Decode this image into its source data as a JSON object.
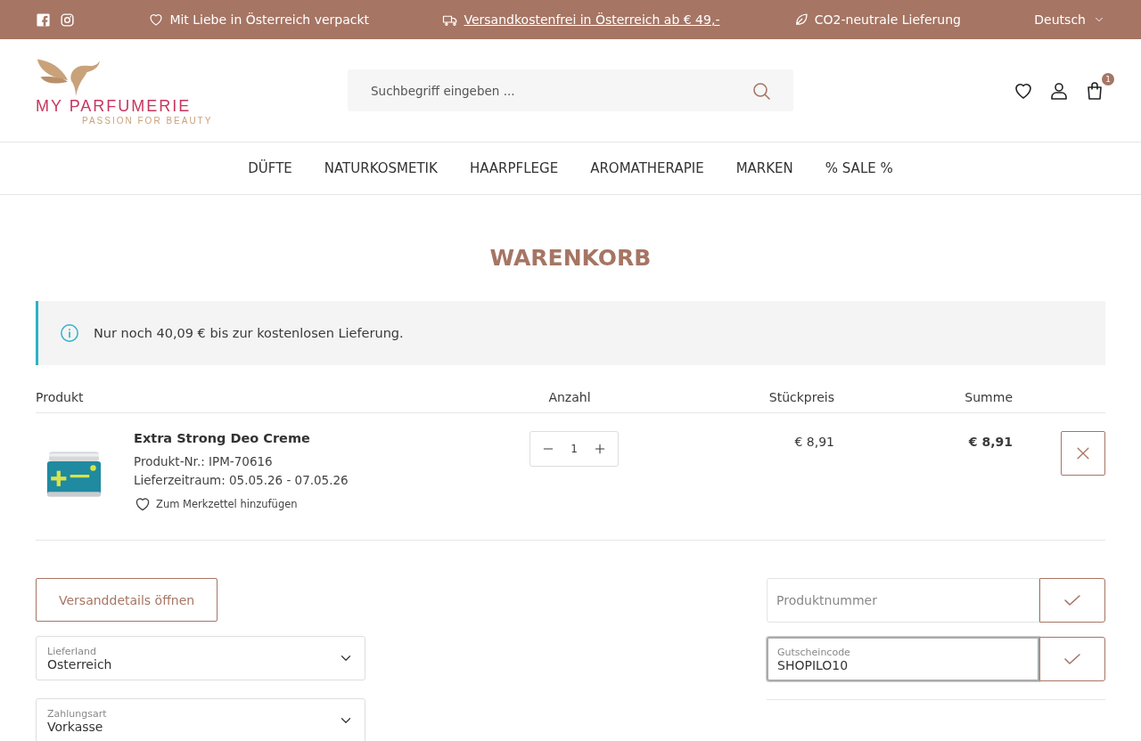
{
  "topbar": {
    "usps": [
      {
        "kind": "heart",
        "text": "Mit Liebe in Österreich verpackt",
        "link": false
      },
      {
        "kind": "truck",
        "text": "Versandkostenfrei in Österreich ab € 49,-",
        "link": true
      },
      {
        "kind": "leaf",
        "text": "CO2-neutrale Lieferung",
        "link": false
      }
    ],
    "language": "Deutsch"
  },
  "header": {
    "logo": {
      "name": "MY PARFUMERIE",
      "tagline": "PASSION FOR BEAUTY"
    },
    "search": {
      "placeholder": "Suchbegriff eingeben ..."
    },
    "cart_count": "1"
  },
  "nav": [
    {
      "label": "DÜFTE"
    },
    {
      "label": "NATURKOSMETIK"
    },
    {
      "label": "HAARPFLEGE"
    },
    {
      "label": "AROMATHERAPIE"
    },
    {
      "label": "MARKEN"
    },
    {
      "label": "% SALE %"
    }
  ],
  "page_title": "WARENKORB",
  "notice": "Nur noch 40,09 € bis zur kostenlosen Lieferung.",
  "table": {
    "columns": [
      "Produkt",
      "Anzahl",
      "Stückpreis",
      "Summe"
    ],
    "rows": [
      {
        "name": "Extra Strong Deo Creme",
        "number": "Produkt-Nr.: IPM-70616",
        "delivery": "Lieferzeitraum: 05.05.26 - 07.05.26",
        "wishlist": "Zum Merkzettel hinzufügen",
        "quantity": "1",
        "unit_price": "€ 8,91",
        "total": "€ 8,91"
      }
    ]
  },
  "shipping_button": "Versanddetails öffnen",
  "selects": [
    {
      "label": "Lieferland",
      "value": "Osterreich"
    },
    {
      "label": "Zahlungsart",
      "value": "Vorkasse"
    }
  ],
  "code_fields": [
    {
      "placeholder": "Produktnummer",
      "focused": false
    },
    {
      "label": "Gutscheincode",
      "value": "SHOPILO10",
      "focused": true
    }
  ]
}
